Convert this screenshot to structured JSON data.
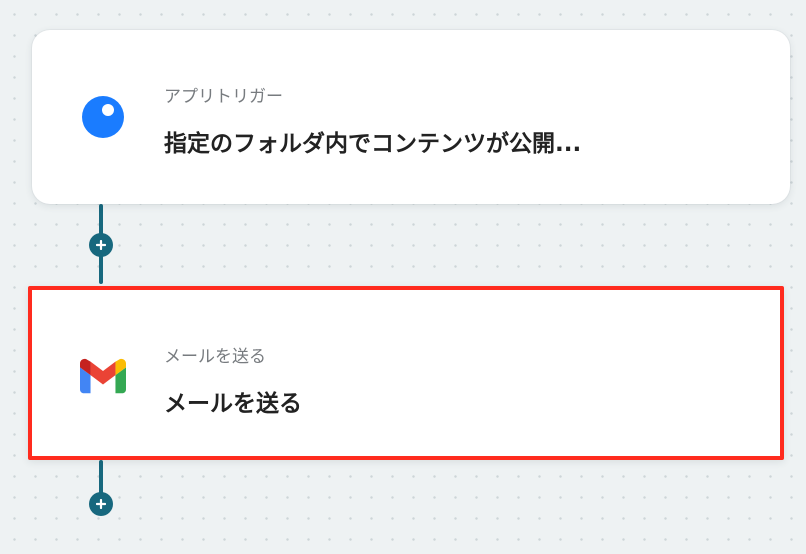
{
  "flow": {
    "steps": [
      {
        "icon": "app-trigger-icon",
        "subtitle": "アプリトリガー",
        "title": "指定のフォルダ内でコンテンツが公開..."
      },
      {
        "icon": "gmail-icon",
        "subtitle": "メールを送る",
        "title": "メールを送る"
      }
    ],
    "add_step_symbol": "+"
  },
  "colors": {
    "connector": "#17687e",
    "selection_border": "#ff2b1e",
    "trigger_icon": "#1a7cff",
    "gmail_red": "#ea4335",
    "gmail_blue": "#4285f4",
    "gmail_green": "#34a853",
    "gmail_yellow": "#fbbc04"
  }
}
